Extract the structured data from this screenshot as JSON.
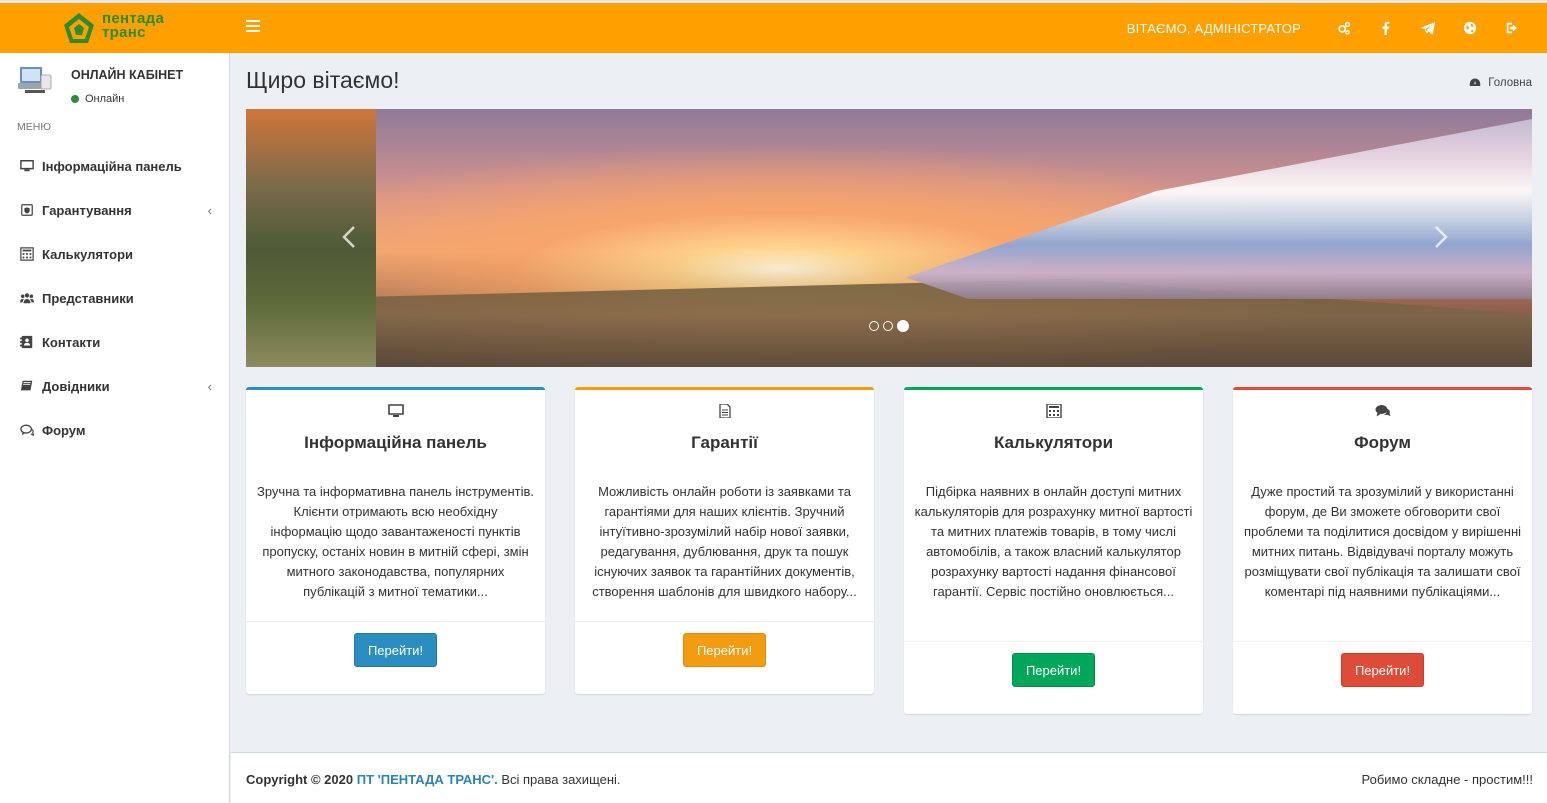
{
  "header": {
    "logo_line1": "пентада",
    "logo_line2": "транс",
    "greeting": "ВІТАЄМО, АДМІНІСТРАТОР",
    "icons": [
      "cogs-icon",
      "facebook-icon",
      "telegram-icon",
      "globe-icon",
      "sign-out-icon"
    ]
  },
  "sidebar": {
    "user_name": "ОНЛАЙН КАБІНЕТ",
    "user_status": "Онлайн",
    "menu_header": "МЕНЮ",
    "items": [
      {
        "label": "Інформаційна панель",
        "icon": "monitor-icon"
      },
      {
        "label": "Гарантування",
        "icon": "shield-icon",
        "has_submenu": true
      },
      {
        "label": "Калькулятори",
        "icon": "calculator-icon"
      },
      {
        "label": "Представники",
        "icon": "users-icon"
      },
      {
        "label": "Контакти",
        "icon": "address-book-icon"
      },
      {
        "label": "Довідники",
        "icon": "book-icon",
        "has_submenu": true
      },
      {
        "label": "Форум",
        "icon": "comments-icon"
      }
    ],
    "chevron": "‹"
  },
  "main": {
    "title": "Щиро вітаємо!",
    "breadcrumb": "Головна",
    "carousel": {
      "slides": 3,
      "active": 3
    }
  },
  "boxes": [
    {
      "title": "Інформаційна панель",
      "icon": "monitor-icon",
      "color": "#2a8ec0",
      "text": "Зручна та інформативна панель інструментів. Клієнти отримають всю необхідну інформацію щодо завантаженості пунктів пропуску, останіх новин в митній сфері, змін митного законодавства, популярних публікацій з митної тематики...",
      "button": "Перейти!"
    },
    {
      "title": "Гарантії",
      "icon": "document-icon",
      "color": "#f39c12",
      "text": "Можливість онлайн роботи із заявками та гарантіями для наших клієнтів. Зручний інтуїтивно-зрозумілий набір нової заявки, редагування, дублювання, друк та пошук існуючих заявок та гарантійних документів, створення шаблонів для швидкого набору...",
      "button": "Перейти!"
    },
    {
      "title": "Калькулятори",
      "icon": "calculator-icon",
      "color": "#00a65a",
      "text": "Підбірка наявних в онлайн доступі митних калькуляторів для розрахунку митної вартості та митних платежів товарів, в тому числі автомобілів, а також власний калькулятор розрахунку вартості надання фінансової гарантії. Сервіс постійно оновлюється...",
      "button": "Перейти!"
    },
    {
      "title": "Форум",
      "icon": "comments-icon",
      "color": "#dd4b39",
      "text": "Дуже простий та зрозумілий у використанні форум, де Ви зможете обговорити свої проблеми та поділитися досвідом у вирішенні митних питань. Відвідувачі порталу можуть розміщувати свої публікація та залишати свої коментарі під наявними публікаціями...",
      "button": "Перейти!"
    }
  ],
  "footer": {
    "copyright_prefix": "Copyright © 2020",
    "company": "ПТ 'ПЕНТАДА ТРАНС'.",
    "rights": "Всі права захищені.",
    "slogan": "Робимо складне - простим!!!"
  }
}
